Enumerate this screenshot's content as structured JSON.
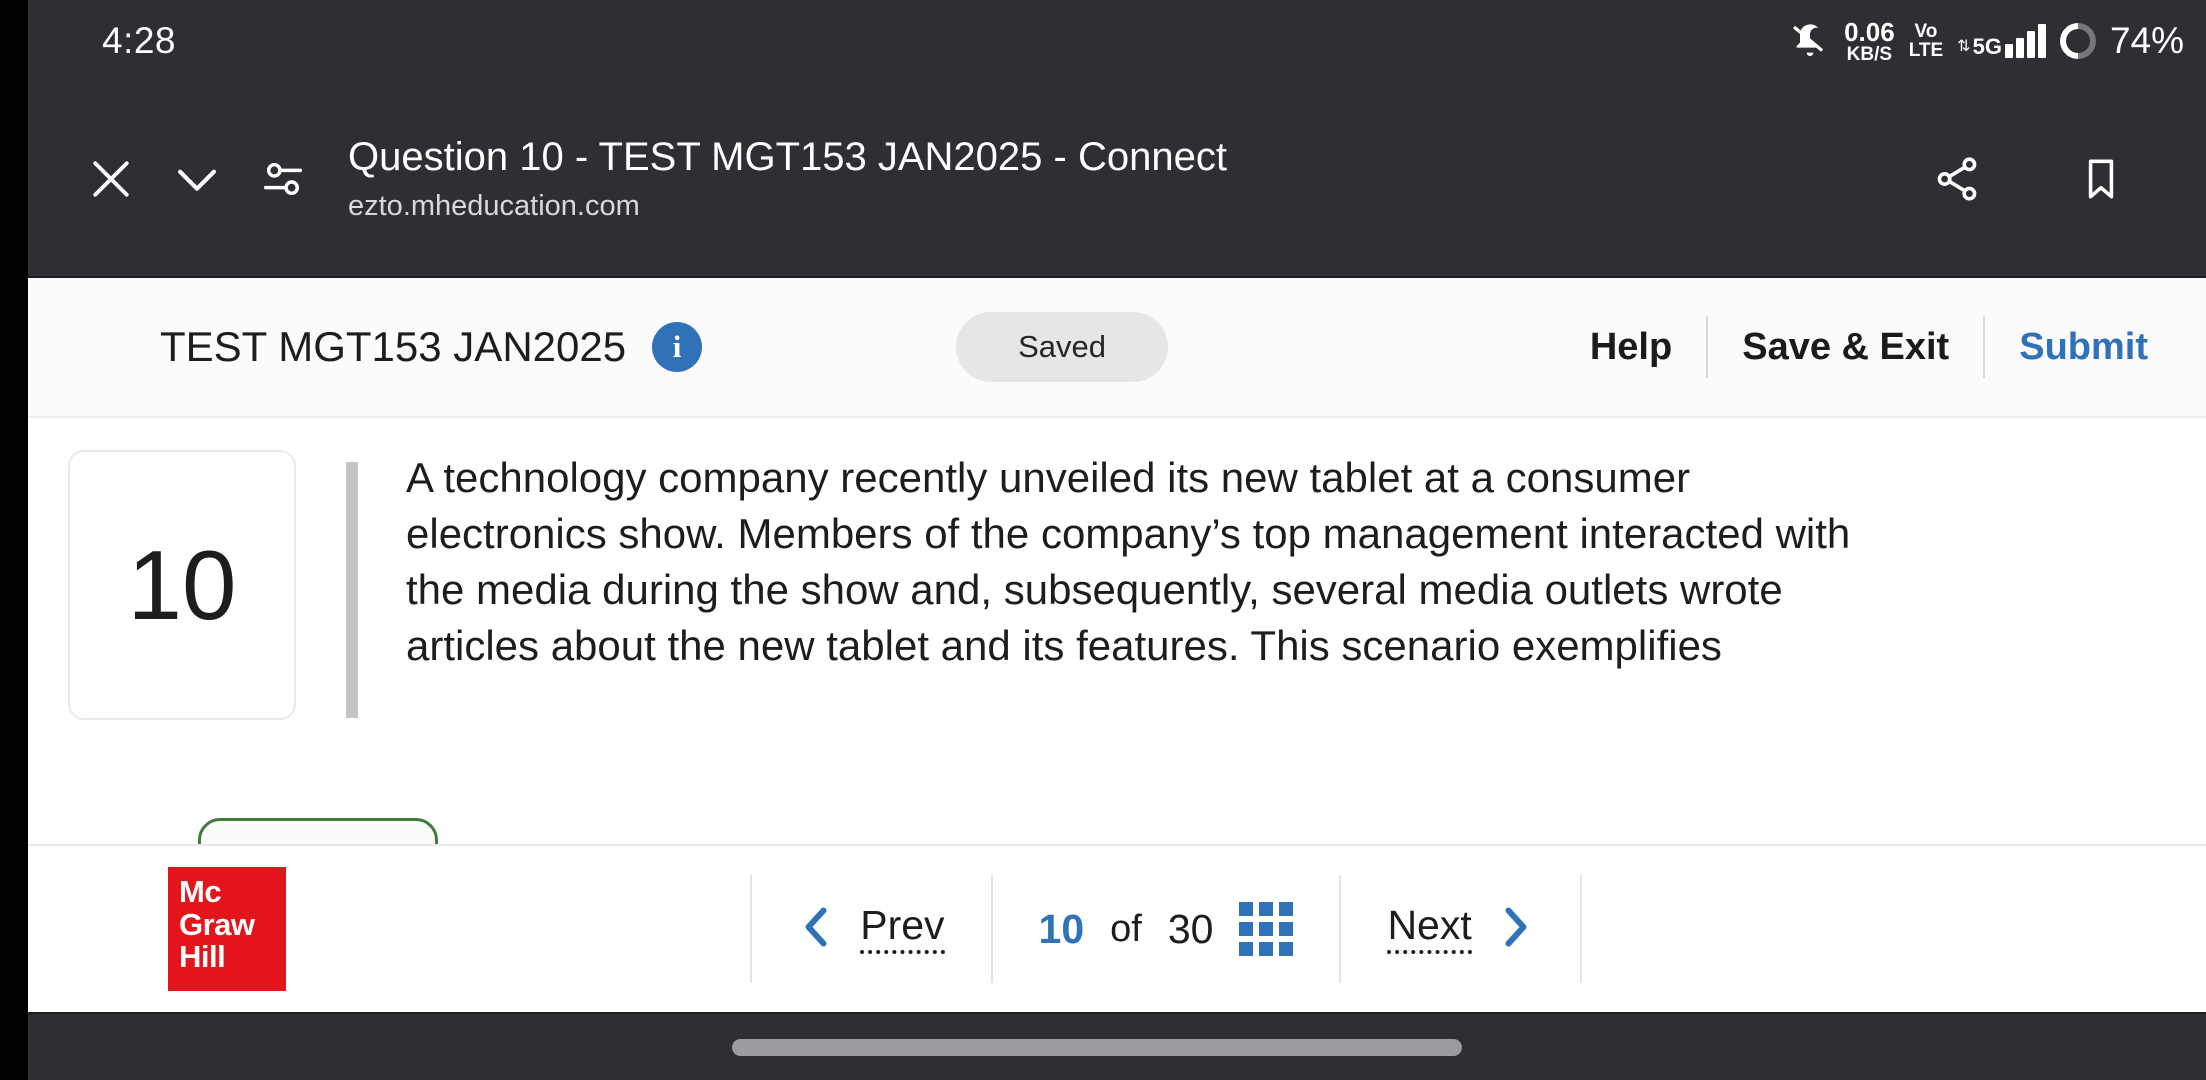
{
  "status_bar": {
    "time": "4:28",
    "notification_icon": "bell-muted-icon",
    "network_speed_value": "0.06",
    "network_speed_unit": "KB/S",
    "volte_line1": "Vo",
    "volte_line2": "LTE",
    "data_arrows": "⇅",
    "network_type": "5G",
    "battery_percent": "74%"
  },
  "browser_bar": {
    "close_icon": "close-icon",
    "collapse_icon": "chevron-down-icon",
    "settings_icon": "page-settings-icon",
    "title": "Question 10 - TEST MGT153 JAN2025 - Connect",
    "url": "ezto.mheducation.com",
    "share_icon": "share-icon",
    "bookmark_icon": "bookmark-icon"
  },
  "app_toolbar": {
    "assignment_title": "TEST MGT153 JAN2025",
    "info_badge": "i",
    "saved_status": "Saved",
    "help_label": "Help",
    "save_exit_label": "Save & Exit",
    "submit_label": "Submit",
    "submit_color": "#2f72b8",
    "info_badge_color": "#2f72b8"
  },
  "question": {
    "number": "10",
    "text": "A technology company recently unveiled its new tablet at a consumer electronics show. Members of the company’s top management interacted with the media during the show and, subsequently, several media outlets wrote articles about the new tablet and its features. This scenario exemplifies"
  },
  "bottom_bar": {
    "logo_line1": "Mc",
    "logo_line2": "Graw",
    "logo_line3": "Hill",
    "logo_color": "#e4141b",
    "prev_label": "Prev",
    "prev_icon": "chevron-left-icon",
    "current_page": "10",
    "of_label": "of",
    "total_pages": "30",
    "grid_icon": "grid-view-icon",
    "next_label": "Next",
    "next_icon": "chevron-right-icon",
    "accent_color": "#2f72b8"
  }
}
